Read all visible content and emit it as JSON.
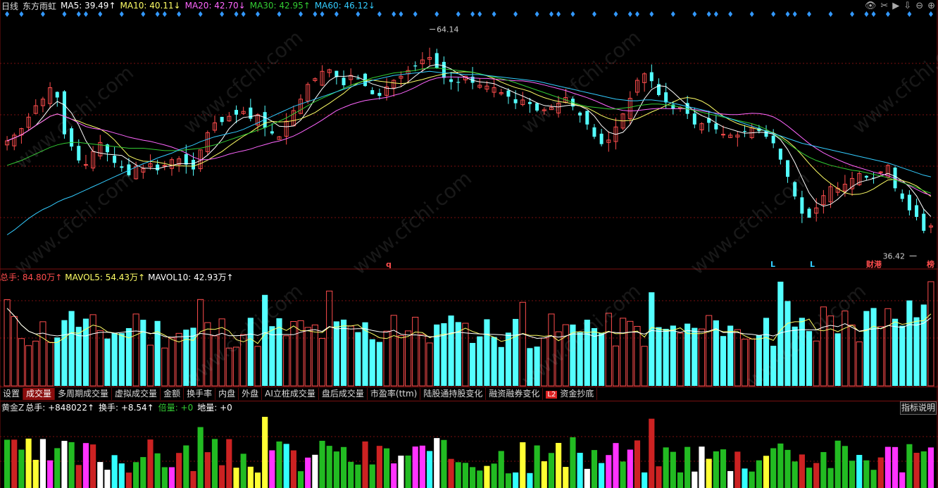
{
  "header": {
    "period": "日线",
    "stock_name": "东方雨虹",
    "ma5": "MA5: 39.49↑",
    "ma10": "MA10: 40.11↓",
    "ma20": "MA20: 42.70↓",
    "ma30": "MA30: 42.95↑",
    "ma60": "MA60: 46.12↓"
  },
  "colors": {
    "up": "#ff4d4d",
    "down": "#54ffff",
    "ma5": "#ffffff",
    "ma10": "#ffff66",
    "ma20": "#ff66ff",
    "ma30": "#33cc33",
    "ma60": "#33ccff",
    "grid": "#7a1010"
  },
  "price_panel": {
    "high_label": "64.14",
    "low_label": "36.42",
    "markers": [
      "q",
      "L",
      "L",
      "财港",
      "榜"
    ]
  },
  "volume_header": {
    "total": "总手: 84.80万↑",
    "mavol5": "MAVOL5: 54.43万↑",
    "mavol10": "MAVOL10: 42.93万↑"
  },
  "tabs": [
    "设置",
    "成交量",
    "多周期成交量",
    "虚拟成交量",
    "金额",
    "换手率",
    "内盘",
    "外盘",
    "AI立桩成交量",
    "盘后成交量",
    "市盈率(ttm)",
    "陆股通持股变化",
    "融资融券变化",
    "资金抄底"
  ],
  "tab_badge": "L2",
  "indicator_header": {
    "name": "黄金Z",
    "total": "总手: +848022↑",
    "turnover": "换手: +8.54↑",
    "multiple": "倍量: +0",
    "ground": "地量: +0"
  },
  "explain_button": "指标说明",
  "watermark": "www.cfchi.com",
  "chart_data": {
    "type": "candlestick",
    "series_count": 130,
    "ylim": [
      35,
      66
    ],
    "high": 64.14,
    "low": 36.42,
    "close_path": [
      50.5,
      51.2,
      52.0,
      53.4,
      54.8,
      55.6,
      57.0,
      55.8,
      51.3,
      49.8,
      48.1,
      47.6,
      49.2,
      50.3,
      49.1,
      47.8,
      47.2,
      46.3,
      47.4,
      47.1,
      47.7,
      46.9,
      47.5,
      48.2,
      48.3,
      47.6,
      47.0,
      49.4,
      51.5,
      52.7,
      52.8,
      53.5,
      53.7,
      54.1,
      53.2,
      53.7,
      52.1,
      51.4,
      51.0,
      52.9,
      54.2,
      55.6,
      57.4,
      58.1,
      59.0,
      59.2,
      58.3,
      57.3,
      58.5,
      58.1,
      57.2,
      56.2,
      56.0,
      57.1,
      57.9,
      58.4,
      59.1,
      59.6,
      60.4,
      60.7,
      59.4,
      58.2,
      57.7,
      57.6,
      58.4,
      57.6,
      57.3,
      57.2,
      57.0,
      56.4,
      55.9,
      55.1,
      55.5,
      55.0,
      54.2,
      54.3,
      54.6,
      55.1,
      55.8,
      54.7,
      53.6,
      52.5,
      51.0,
      50.1,
      50.6,
      52.2,
      53.8,
      55.7,
      57.9,
      58.7,
      57.8,
      56.1,
      55.2,
      54.4,
      54.6,
      53.8,
      52.5,
      52.6,
      52.7,
      51.9,
      51.3,
      51.2,
      51.2,
      51.6,
      52.1,
      51.7,
      51.0,
      50.2,
      48.2,
      46.1,
      43.7,
      41.6,
      41.1,
      42.3,
      43.8,
      44.9,
      44.7,
      45.2,
      45.9,
      46.5,
      46.0,
      45.9,
      46.7,
      47.5,
      44.7,
      43.4,
      42.0,
      41.2,
      39.5,
      40.1
    ],
    "ma60_path": [
      39.0,
      39.6,
      40.3,
      41.0,
      41.6,
      42.1,
      42.5,
      43.0,
      43.4,
      43.7,
      44.1,
      44.5,
      44.9,
      45.3,
      45.7,
      46.1,
      46.5,
      46.9,
      47.3,
      47.7,
      48.0,
      48.4,
      48.7,
      49.0,
      49.4,
      49.7,
      50.0,
      50.4,
      50.7,
      51.0,
      51.2,
      51.4,
      51.6,
      51.9,
      52.3,
      52.7,
      53.1,
      53.5,
      53.9,
      54.3,
      54.7,
      55.0,
      55.3,
      55.6,
      55.9,
      56.2,
      56.5,
      56.8,
      57.1,
      57.4,
      57.6,
      57.9,
      58.1,
      58.3,
      58.5,
      58.6,
      58.7,
      58.8,
      58.9,
      59.0,
      58.9,
      58.8,
      58.8,
      58.7,
      58.6,
      58.6,
      58.6,
      58.5,
      58.4,
      58.3,
      58.2,
      58.1,
      58.0,
      57.9,
      57.8,
      57.6,
      57.4,
      57.2,
      57.0,
      56.8,
      56.6,
      56.4,
      56.2,
      56.0,
      55.8,
      55.6,
      55.5,
      55.4,
      55.4,
      55.5,
      55.5,
      55.4,
      55.3,
      55.1,
      54.9,
      54.7,
      54.5,
      54.3,
      54.1,
      53.8,
      53.5,
      53.2,
      52.9,
      52.6,
      52.3,
      52.0,
      51.7,
      51.4,
      51.1,
      50.8,
      50.5,
      50.2,
      50.0,
      49.8,
      49.6,
      49.4,
      49.2,
      49.0,
      48.8,
      48.6,
      48.4,
      48.2,
      48.0,
      47.8,
      47.5,
      47.2,
      46.9,
      46.6,
      46.3,
      46.1
    ],
    "ma30_path": [
      47.5,
      47.8,
      48.1,
      48.5,
      48.9,
      49.3,
      49.7,
      50.0,
      50.2,
      50.3,
      50.3,
      50.2,
      50.1,
      50.0,
      49.9,
      49.8,
      49.7,
      49.6,
      49.6,
      49.6,
      49.5,
      49.4,
      49.3,
      49.3,
      49.3,
      49.4,
      49.5,
      49.6,
      49.8,
      50.0,
      50.3,
      50.6,
      50.9,
      51.2,
      51.5,
      51.8,
      52.1,
      52.5,
      52.9,
      53.3,
      53.8,
      54.3,
      54.8,
      55.3,
      55.7,
      56.1,
      56.5,
      56.9,
      57.3,
      57.6,
      57.9,
      58.2,
      58.4,
      58.6,
      58.8,
      58.9,
      59.0,
      59.1,
      59.3,
      59.4,
      59.4,
      59.3,
      59.2,
      59.1,
      59.0,
      58.9,
      58.7,
      58.5,
      58.3,
      58.1,
      57.9,
      57.6,
      57.3,
      57.0,
      56.7,
      56.4,
      56.1,
      55.8,
      55.5,
      55.2,
      54.9,
      54.7,
      54.6,
      54.5,
      54.4,
      54.4,
      54.5,
      54.6,
      54.8,
      54.9,
      55.0,
      55.0,
      54.9,
      54.8,
      54.6,
      54.4,
      54.2,
      54.0,
      53.8,
      53.6,
      53.4,
      53.2,
      53.0,
      52.8,
      52.6,
      52.3,
      51.9,
      51.4,
      50.8,
      50.2,
      49.6,
      49.0,
      48.5,
      48.1,
      47.8,
      47.5,
      47.3,
      47.1,
      46.9,
      46.8,
      46.6,
      46.4,
      46.2,
      46.0,
      45.7,
      45.4,
      45.1,
      44.8,
      44.4,
      44.1
    ]
  }
}
